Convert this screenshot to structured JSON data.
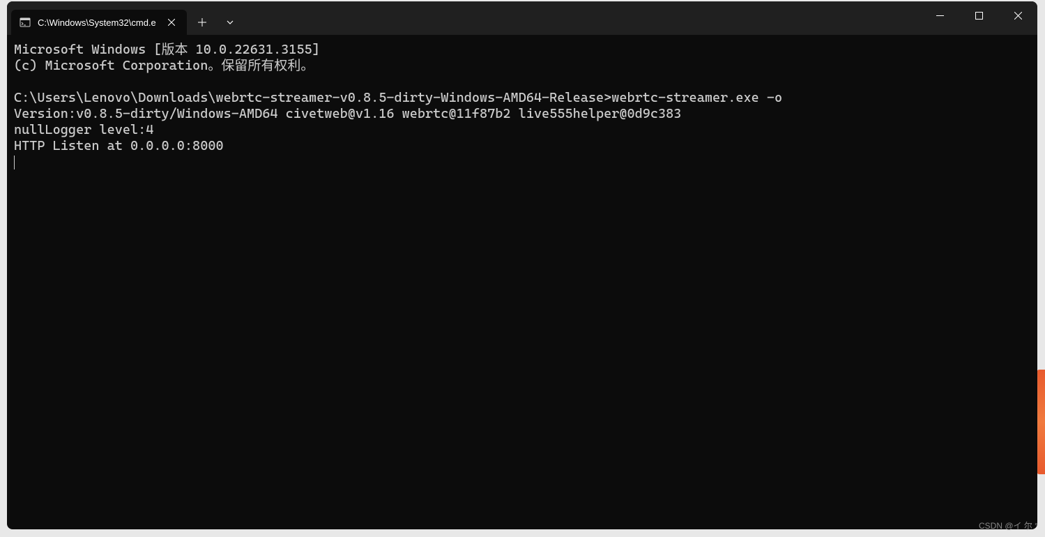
{
  "tab": {
    "title": "C:\\Windows\\System32\\cmd.e"
  },
  "terminal": {
    "lines": [
      "Microsoft Windows [版本 10.0.22631.3155]",
      "(c) Microsoft Corporation。保留所有权利。",
      "",
      "C:\\Users\\Lenovo\\Downloads\\webrtc-streamer-v0.8.5-dirty-Windows-AMD64-Release>webrtc-streamer.exe -o",
      "Version:v0.8.5-dirty/Windows-AMD64 civetweb@v1.16 webrtc@11f87b2 live555helper@0d9c383",
      "nullLogger level:4",
      "HTTP Listen at 0.0.0.0:8000"
    ]
  },
  "watermark": "CSDN @イ 尔 °"
}
